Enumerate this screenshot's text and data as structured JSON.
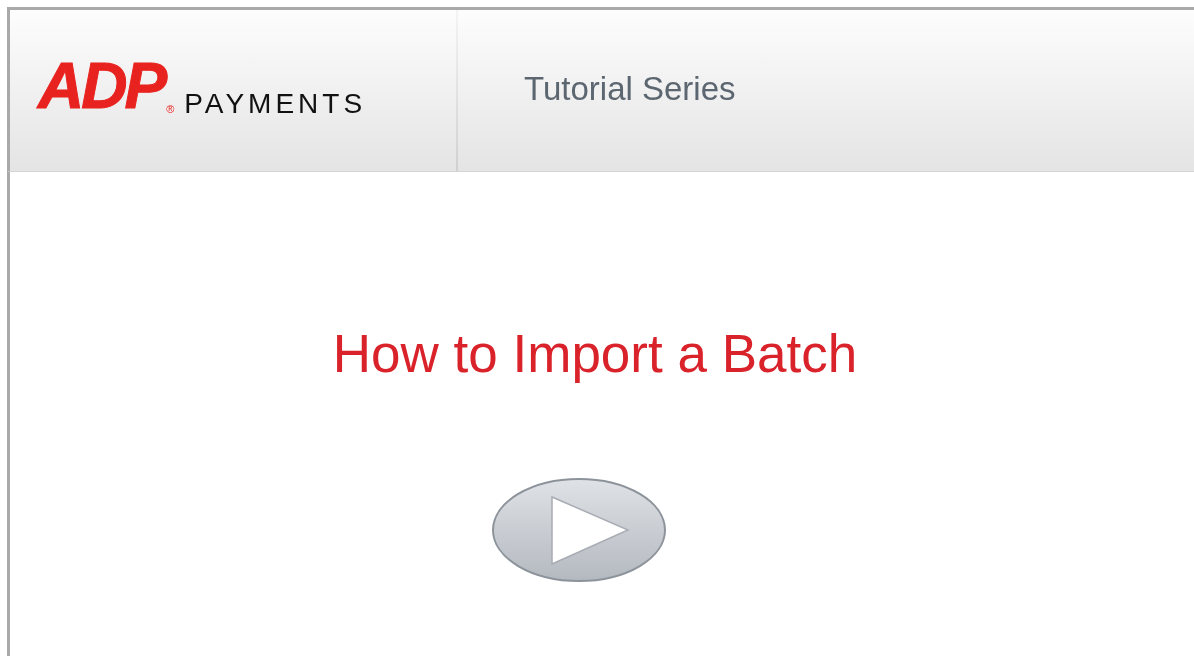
{
  "header": {
    "logo": {
      "mark": "ADP",
      "registered": "®",
      "product": "PAYMENTS"
    },
    "series_title": "Tutorial Series"
  },
  "title": "How to Import a Batch"
}
